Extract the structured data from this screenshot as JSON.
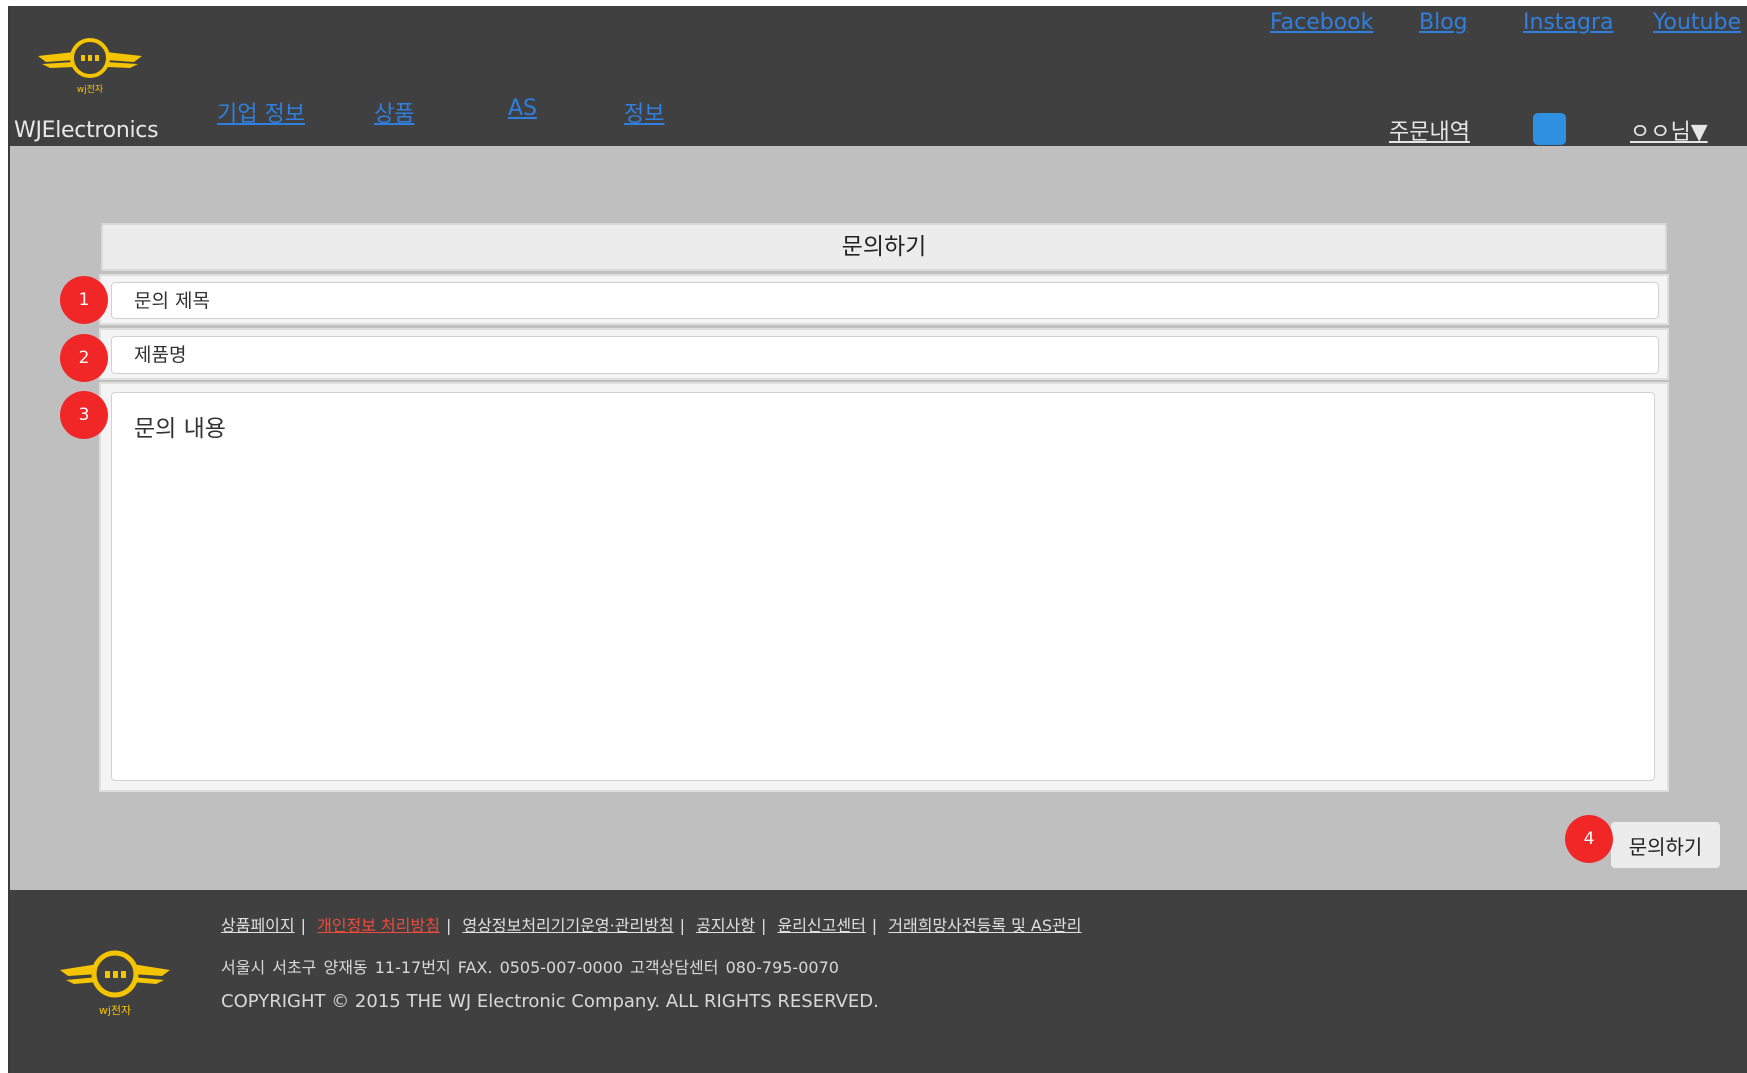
{
  "header": {
    "brand": "WJElectronics",
    "logo_text": "wj전자",
    "nav": [
      {
        "label": "기업 정보"
      },
      {
        "label": "상품"
      },
      {
        "label": "AS"
      },
      {
        "label": "정보"
      }
    ],
    "social": [
      {
        "label": "Facebook"
      },
      {
        "label": "Blog"
      },
      {
        "label": "Instagra"
      },
      {
        "label": "Youtube"
      }
    ],
    "order_history": "주문내역",
    "user_menu": "ㅇㅇ님▼",
    "cart_icon": "blue-square-icon",
    "colors": {
      "header_bg": "#404040",
      "link": "#2f7fe0",
      "accent_square": "#2e90e0"
    }
  },
  "form": {
    "title": "문의하기",
    "subject_placeholder": "문의 제목",
    "product_placeholder": "제품명",
    "content_placeholder": "문의 내용",
    "submit_label": "문의하기",
    "markers": [
      "1",
      "2",
      "3",
      "4"
    ],
    "colors": {
      "marker": "#f12626",
      "page_bg": "#bfbfbf"
    }
  },
  "footer": {
    "links": [
      {
        "label": "상품페이지"
      },
      {
        "label": "개인정보 처리방침",
        "highlight": true
      },
      {
        "label": "영상정보처리기기운영·관리방침"
      },
      {
        "label": "공지사항"
      },
      {
        "label": "윤리신고센터"
      },
      {
        "label": "거래희망사전등록 및 AS관리"
      }
    ],
    "address": "서울시 서초구 양재동 11-17번지   FAX. 0505-007-0000   고객상담센터 080-795-0070",
    "copyright": "COPYRIGHT © 2015 THE WJ Electronic Company.  ALL RIGHTS RESERVED.",
    "logo_text": "wj전자",
    "colors": {
      "footer_bg": "#404040",
      "highlight_link": "#f04a3a"
    }
  }
}
